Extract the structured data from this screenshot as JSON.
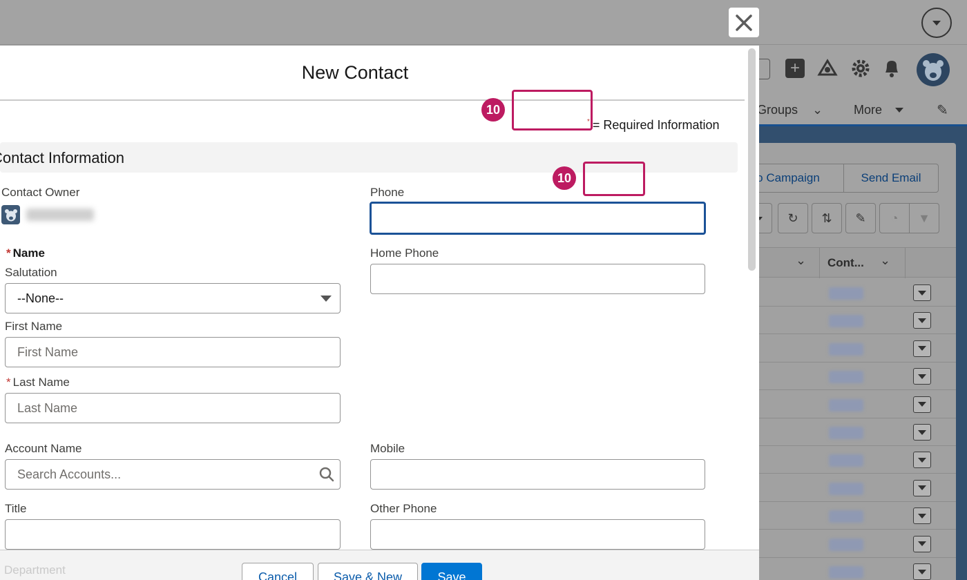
{
  "modal": {
    "title": "New Contact",
    "close_icon": "close-icon",
    "required_info": "= Required Information",
    "section_title": "Contact Information",
    "fields": {
      "contact_owner": {
        "label": "Contact Owner"
      },
      "phone": {
        "label": "Phone",
        "value": ""
      },
      "name": {
        "label": "Name"
      },
      "home_phone": {
        "label": "Home Phone",
        "value": ""
      },
      "salutation": {
        "label": "Salutation",
        "value": "--None--"
      },
      "first_name": {
        "label": "First Name",
        "placeholder": "First Name"
      },
      "last_name": {
        "label": "Last Name",
        "placeholder": "Last Name"
      },
      "account_name": {
        "label": "Account Name",
        "placeholder": "Search Accounts..."
      },
      "mobile": {
        "label": "Mobile",
        "value": ""
      },
      "title": {
        "label": "Title",
        "value": ""
      },
      "other_phone": {
        "label": "Other Phone",
        "value": ""
      },
      "department": {
        "label": "Department"
      }
    },
    "buttons": {
      "cancel": "Cancel",
      "save_new": "Save & New",
      "save": "Save"
    }
  },
  "annotations": [
    {
      "badge": "10",
      "color": "#bd1b61"
    },
    {
      "badge": "10",
      "color": "#bd1b61"
    }
  ],
  "background_app": {
    "nav": {
      "groups": "Groups",
      "more": "More"
    },
    "actions": {
      "campaign": "o Campaign",
      "send_email": "Send Email"
    },
    "table_header": {
      "col": "Cont..."
    },
    "header_icons": [
      "chevron-down-icon",
      "add-icon",
      "trailhead-icon",
      "setup-gear-icon",
      "notification-bell-icon",
      "avatar-icon"
    ],
    "row_count": 11
  }
}
